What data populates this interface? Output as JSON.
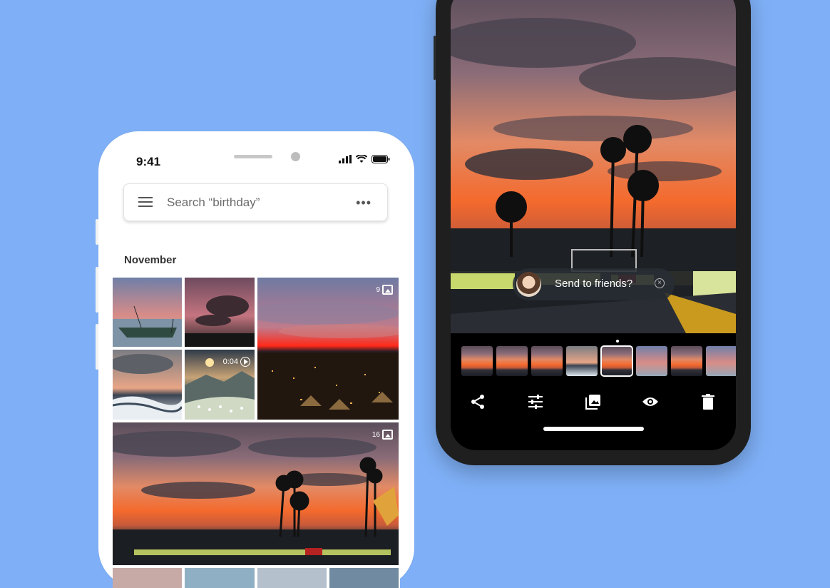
{
  "left_phone": {
    "status_time": "9:41",
    "search_placeholder": "Search “birthday”",
    "section_title": "November",
    "tiles": {
      "video_duration": "0:04",
      "album_count_1": "9",
      "album_count_2": "16"
    }
  },
  "right_phone": {
    "share_chip_text": "Send to friends?",
    "toolbar_icons": [
      "share-icon",
      "adjust-icon",
      "photo-icon",
      "lens-icon",
      "trash-icon"
    ],
    "filmstrip_count": 8,
    "filmstrip_selected_index": 4
  },
  "colors": {
    "background": "#7fb0f7",
    "phone_white": "#ffffff",
    "phone_dark": "#1f1f1f",
    "sky_orange": "#f07a3a",
    "sky_purple": "#6b5a78"
  }
}
